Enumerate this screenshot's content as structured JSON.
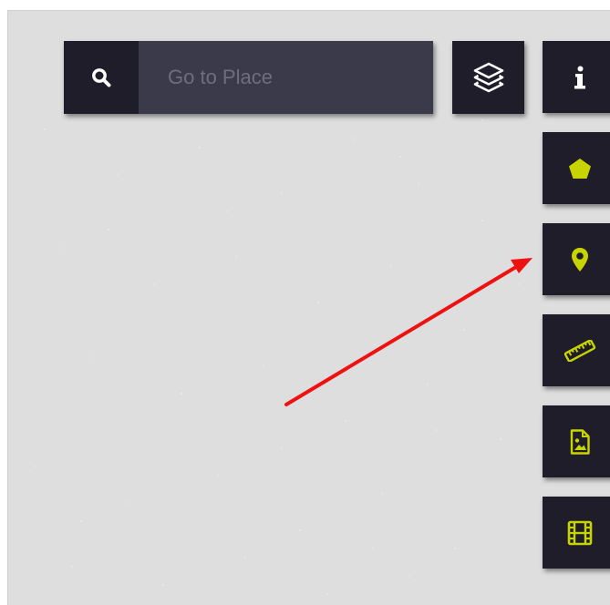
{
  "search": {
    "placeholder": "Go to Place",
    "value": ""
  },
  "toolbar": {
    "icons": {
      "search": "search-icon",
      "layers": "layers-icon",
      "info": "info-icon",
      "polygon": "pentagon-icon",
      "marker": "map-marker-icon",
      "measure": "ruler-icon",
      "image": "image-file-icon",
      "video": "film-icon"
    }
  },
  "colors": {
    "button_bg": "#1e1d29",
    "input_bg": "#3b3a4a",
    "accent": "#c8d400",
    "map_bg": "#dedede",
    "annotation_arrow": "#ee1111"
  }
}
